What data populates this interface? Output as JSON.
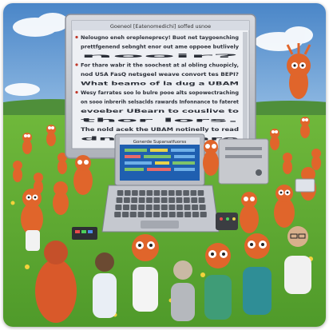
{
  "scene": {
    "colors": {
      "sky_top": "#4a86c8",
      "sky_bottom": "#b9d8f2",
      "grass": "#5fa832",
      "grass_dark": "#3f8a22",
      "monitor_body": "#c9ccd2",
      "screen_bg": "#eef0f4",
      "creature": "#e0652b",
      "laptop_body": "#b9bcc4",
      "laptop_screen": "#1f5fb0"
    }
  },
  "monitor": {
    "window_title": "Goeneol [Eatenomedichi] soffed usnoe",
    "lines": [
      {
        "text": "Nelougno eneh orepleneprecy! Buot net taygoenching",
        "bullet": true
      },
      {
        "text": "prettfgenend sebnght enor out ame oppoee butlively",
        "bullet": false
      },
      {
        "text": "nooir?",
        "bullet": false
      },
      {
        "text": "For thare wabr it the soochest at al obling chuopicly,",
        "bullet": true
      },
      {
        "text": "nod USA FasQ netsgeel weave convort tes BEPI?",
        "bullet": false
      },
      {
        "text": "What beamo of la dug a UBAM",
        "bullet": false
      },
      {
        "text": "Wesy farrates soo lo bulre pooe alts sopowectraching",
        "bullet": true
      },
      {
        "text": "on sooo inbrerih selsaclds rawards Infonnance to fateret",
        "bullet": false
      },
      {
        "text": "evoeber UBearn to couslive to",
        "bullet": false
      },
      {
        "text": "thor lors.",
        "bullet": false
      },
      {
        "text": "The nold acek the UBAM notinelly to read",
        "bullet": false
      },
      {
        "text": "dnad abare",
        "bullet": false
      }
    ]
  },
  "laptop": {
    "window_title": "Gonerde Suparsatfuorss"
  }
}
